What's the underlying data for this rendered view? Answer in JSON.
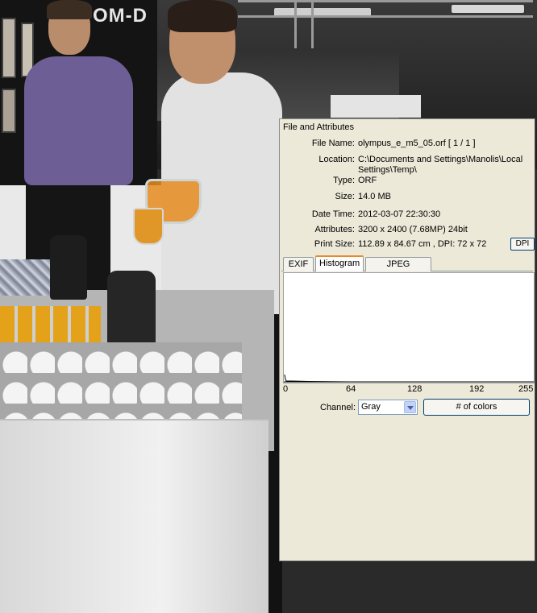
{
  "photo": {
    "booth_sign": "OM-D"
  },
  "panel": {
    "title": "File and Attributes",
    "fields": [
      {
        "label": "File Name:",
        "value": "olympus_e_m5_05.orf   [ 1 / 1 ]"
      },
      {
        "label": "Location:",
        "value": "C:\\Documents and Settings\\Manolis\\Local",
        "value2": "Settings\\Temp\\"
      },
      {
        "label": "Type:",
        "value": "ORF"
      },
      {
        "label": "Size:",
        "value": "14.0 MB"
      },
      {
        "label": "Date Time:",
        "value": "2012-03-07 22:30:30"
      },
      {
        "label": "Attributes:",
        "value": "3200 x 2400 (7.68MP)   24bit"
      },
      {
        "label": "Print Size:",
        "value": "112.89 x 84.67 cm ,   DPI: 72 x 72"
      }
    ],
    "dpi_button": "DPI",
    "tabs": [
      {
        "label": "EXIF",
        "active": false
      },
      {
        "label": "Histogram",
        "active": true
      },
      {
        "label": "JPEG Comment",
        "active": false
      }
    ],
    "histogram": {
      "axis_labels": [
        "0",
        "64",
        "128",
        "192",
        "255"
      ],
      "line_color": "#000000"
    },
    "channel": {
      "label": "Channel:",
      "selected": "Gray"
    },
    "colors_button": "# of colors"
  }
}
